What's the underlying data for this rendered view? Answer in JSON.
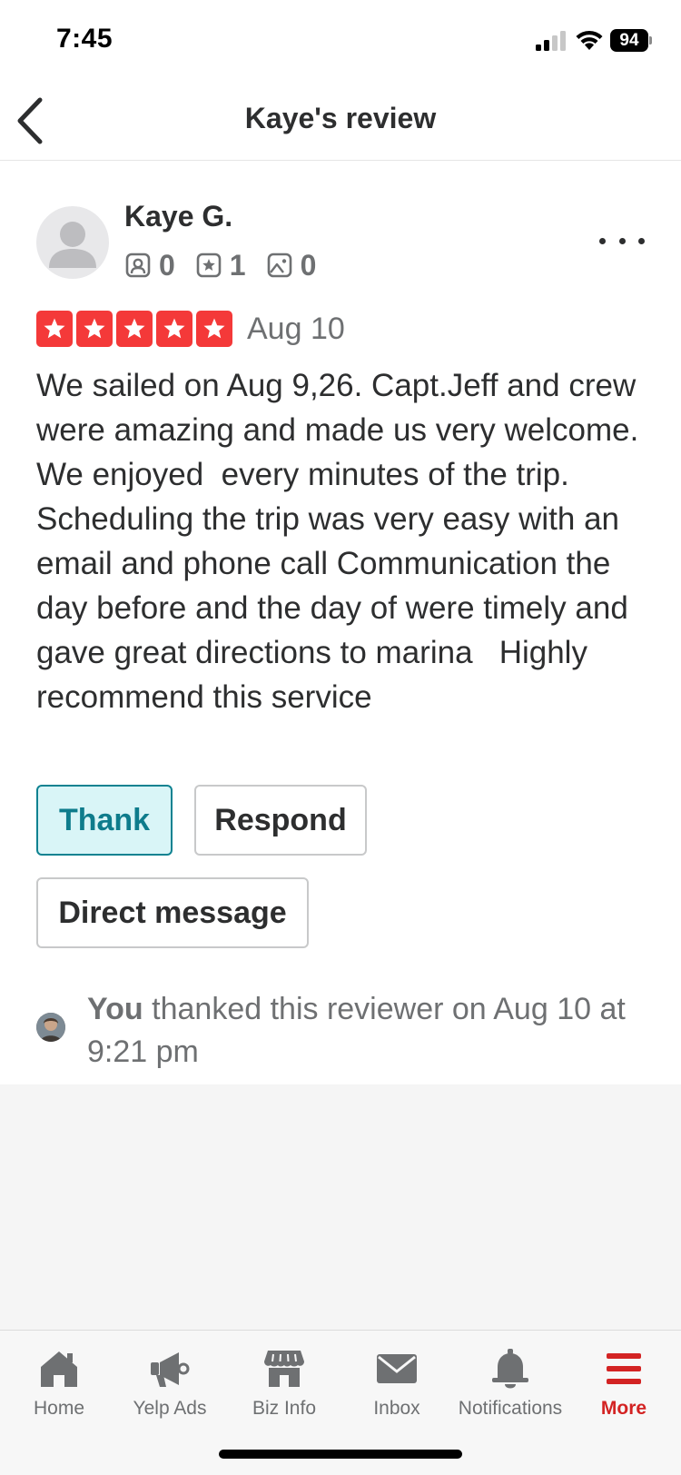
{
  "status_bar": {
    "time": "7:45",
    "battery": "94"
  },
  "header": {
    "title": "Kaye's review"
  },
  "reviewer": {
    "name": "Kaye G.",
    "friends_count": "0",
    "reviews_count": "1",
    "photos_count": "0"
  },
  "review": {
    "rating": 5,
    "date": "Aug 10",
    "text": "We sailed on Aug 9,26. Capt.Jeff and crew were amazing and made us very welcome. We enjoyed  every minutes of the trip. Scheduling the trip was very easy with an email and phone call Communication the day before and the day of were timely and gave great directions to marina   Highly recommend this service"
  },
  "actions": {
    "thank_label": "Thank",
    "respond_label": "Respond",
    "dm_label": "Direct message"
  },
  "thanked_note": {
    "you": "You",
    "text": " thanked this reviewer on Aug 10 at 9:21 pm"
  },
  "tabs": [
    {
      "label": "Home",
      "icon": "home-icon"
    },
    {
      "label": "Yelp Ads",
      "icon": "megaphone-icon"
    },
    {
      "label": "Biz Info",
      "icon": "storefront-icon"
    },
    {
      "label": "Inbox",
      "icon": "envelope-icon"
    },
    {
      "label": "Notifications",
      "icon": "bell-icon"
    },
    {
      "label": "More",
      "icon": "menu-icon",
      "active": true
    }
  ],
  "colors": {
    "star_red": "#f43939",
    "accent_red": "#d32323",
    "thank_teal": "#0e8291",
    "thank_bg": "#d9f5f7",
    "icon_gray": "#6e7072"
  }
}
